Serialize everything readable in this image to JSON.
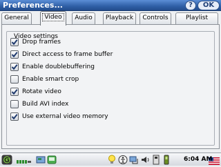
{
  "window": {
    "title": "Preferences...",
    "help_label": "?",
    "ok_label": "OK"
  },
  "tabs": [
    {
      "label": "General",
      "active": false
    },
    {
      "label": "Video",
      "active": true
    },
    {
      "label": "Audio",
      "active": false
    },
    {
      "label": "Playback",
      "active": false
    },
    {
      "label": "Controls",
      "active": false
    },
    {
      "label": "Playlist",
      "active": false
    }
  ],
  "video_settings": {
    "group_label": "Video settings",
    "options": [
      {
        "label": "Drop frames",
        "checked": true
      },
      {
        "label": "Direct access to frame buffer",
        "checked": true
      },
      {
        "label": "Enable doublebuffering",
        "checked": true
      },
      {
        "label": "Enable smart crop",
        "checked": false
      },
      {
        "label": "Rotate video",
        "checked": true
      },
      {
        "label": "Build AVI index",
        "checked": false
      },
      {
        "label": "Use external video memory",
        "checked": true
      }
    ]
  },
  "taskbar": {
    "time": "6:04 AM",
    "icons": [
      "start-menu-icon",
      "battery-status-icon",
      "desktop-icon",
      "app-icon",
      "lightbulb-icon",
      "accessibility-icon",
      "network-icon",
      "speaker-icon",
      "hardware-status-icon",
      "keyboard-icon",
      "us-flag-icon"
    ]
  },
  "colors": {
    "titlebar": "#2f5fa6",
    "checkmark": "#1f3a6e",
    "panel": "#f2f3f5"
  }
}
